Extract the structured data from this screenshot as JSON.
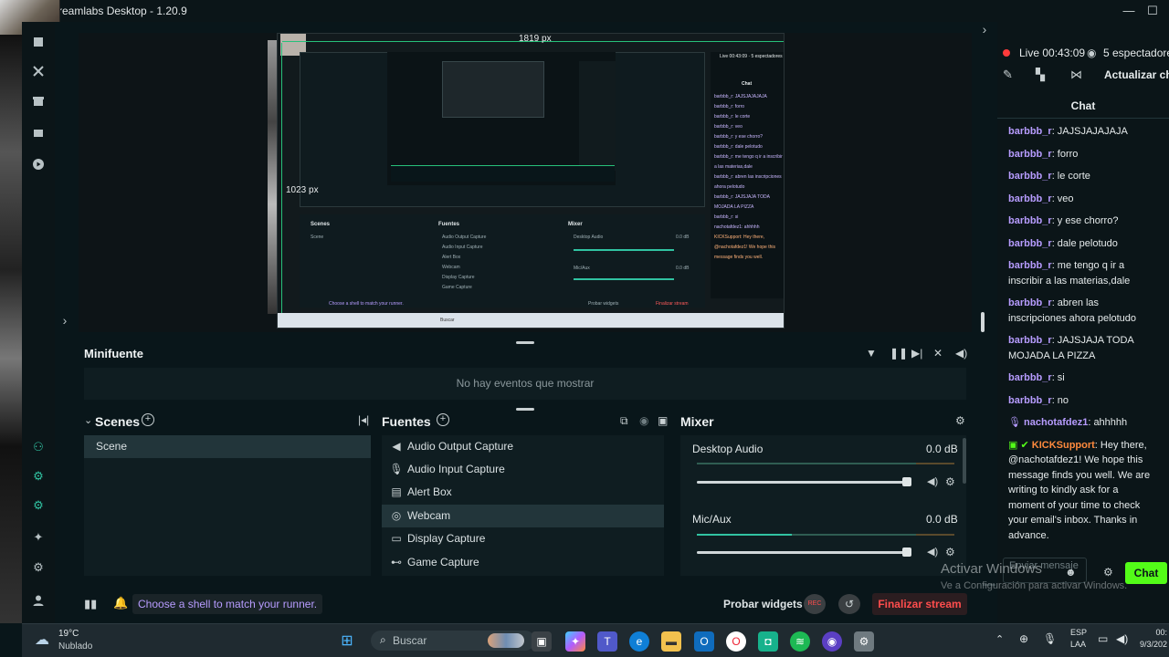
{
  "window": {
    "title": "reamlabs Desktop - 1.20.9",
    "minimize": "—",
    "maximize": "☐"
  },
  "editor": {
    "width_label": "1819 px",
    "height_label": "1023 px",
    "nested": {
      "status": "Live 00:43:09 · 5 espectadores",
      "chat_header": "Chat",
      "scenes": "Scenes",
      "sources": "Fuentes",
      "mixer": "Mixer",
      "scene": "Scene",
      "src1": "Audio Output Capture",
      "src2": "Audio Input Capture",
      "src3": "Alert Box",
      "src4": "Webcam",
      "src5": "Display Capture",
      "src6": "Game Capture",
      "desk": "Desktop Audio",
      "mic": "Mic/Aux",
      "db": "0.0 dB",
      "shell": "Choose a shell to match your runner.",
      "probar": "Probar widgets",
      "finalizar": "Finalizar stream",
      "search": "Buscar",
      "no_events": "No hay eventos que mostrar",
      "chat_lines": [
        "barbbb_r: JAJSJAJAJAJA",
        "barbbb_r: forro",
        "barbbb_r: le corte",
        "barbbb_r: veo",
        "barbbb_r: y ese chorro?",
        "barbbb_r: dale pelotudo",
        "barbbb_r: me tengo q ir a inscribir a las materias,dale",
        "barbbb_r: abren las inscripciones ahora pelotudo",
        "barbbb_r: JAJSJAJA TODA MOJADA LA PIZZA",
        "barbbb_r: si",
        "nachotafdez1: ahhhhh",
        "KICKSupport: Hey there, @nachotafdez1! We hope this message finds you well."
      ]
    }
  },
  "minifuente": {
    "title": "Minifuente",
    "empty": "No hay eventos que mostrar"
  },
  "scenes": {
    "title": "Scenes",
    "items": [
      "Scene"
    ]
  },
  "sources": {
    "title": "Fuentes",
    "items": [
      "Audio Output Capture",
      "Audio Input Capture",
      "Alert Box",
      "Webcam",
      "Display Capture",
      "Game Capture"
    ]
  },
  "mixer": {
    "title": "Mixer",
    "channels": [
      {
        "name": "Desktop Audio",
        "level": "0.0 dB",
        "volume": 1.0
      },
      {
        "name": "Mic/Aux",
        "level": "0.0 dB",
        "volume": 1.0
      }
    ]
  },
  "bottom": {
    "hint": "Choose a shell to match your runner.",
    "test_widgets": "Probar widgets",
    "rec": "REC",
    "end_stream": "Finalizar stream"
  },
  "live": {
    "status": "Live 00:43:09",
    "viewers": "5 espectadores",
    "update_chat": "Actualizar chat"
  },
  "chat": {
    "title": "Chat",
    "messages": [
      {
        "user": "barbbb_r",
        "text": ": JAJSJAJAJAJA"
      },
      {
        "user": "barbbb_r",
        "text": ": forro"
      },
      {
        "user": "barbbb_r",
        "text": ": le corte"
      },
      {
        "user": "barbbb_r",
        "text": ": veo"
      },
      {
        "user": "barbbb_r",
        "text": ": y ese chorro?"
      },
      {
        "user": "barbbb_r",
        "text": ": dale pelotudo"
      },
      {
        "user": "barbbb_r",
        "text": ": me tengo q ir a inscribir a las materias,dale"
      },
      {
        "user": "barbbb_r",
        "text": ": abren las inscripciones ahora pelotudo"
      },
      {
        "user": "barbbb_r",
        "text": ": JAJSJAJA TODA MOJADA LA PIZZA"
      },
      {
        "user": "barbbb_r",
        "text": ": si"
      },
      {
        "user": "barbbb_r",
        "text": ": no"
      },
      {
        "user": "nachotafdez1",
        "text": ": ahhhhh"
      },
      {
        "user": "KICKSupport",
        "text": ": Hey there, @nachotafdez1! We hope this message finds you well. We are writing to kindly ask for a moment of your time to check your email's inbox. Thanks in advance."
      }
    ],
    "input_placeholder": "Enviar mensaje",
    "send": "Chat"
  },
  "watermark": {
    "line1": "Activar Windows",
    "line2": "Ve a Configuración para activar Windows."
  },
  "taskbar": {
    "weather_temp": "19°C",
    "weather_desc": "Nublado",
    "search": "Buscar",
    "lang1": "ESP",
    "lang2": "LAA",
    "time": "00:",
    "date": "9/3/202"
  },
  "colors": {
    "accent": "#31c3a2",
    "live": "#ff3b3b",
    "end": "#ff4d4d",
    "kick": "#53fc18"
  }
}
